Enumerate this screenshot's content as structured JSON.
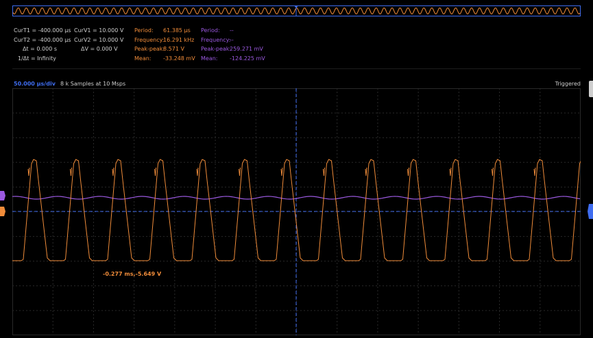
{
  "measurements": {
    "cursors": [
      {
        "label": "CurT1 = -400.000 µs",
        "value_label": "CurV1 = 10.000 V"
      },
      {
        "label": "CurT2 = -400.000 µs",
        "value_label": "CurV2 = 10.000 V"
      },
      {
        "label": "Δt = 0.000 s",
        "value_label": "ΔV = 0.000 V"
      },
      {
        "label": "1/Δt = Infinity",
        "value_label": ""
      }
    ],
    "channel1": {
      "period_label": "Period:",
      "period": "61.385 µs",
      "frequency_label": "Frequency:",
      "frequency": "16.291 kHz",
      "peak_peak_label": "Peak-peak:",
      "peak_peak": "8.571 V",
      "mean_label": "Mean:",
      "mean": "-33.248 mV"
    },
    "channel2": {
      "period_label": "Period:",
      "period": "--",
      "frequency_label": "Frequency:",
      "frequency": "--",
      "peak_peak_label": "Peak-peak:",
      "peak_peak": "259.271 mV",
      "mean_label": "Mean:",
      "mean": "-124.225 mV"
    }
  },
  "status": {
    "timebase": "50.000 µs/div",
    "samples": "8 k Samples at 10 Msps",
    "trigger_state": "Triggered"
  },
  "cursor_readout": "-0.277 ms,-5.649 V",
  "colors": {
    "ch1": "#f08c3a",
    "ch2": "#9b59e0",
    "cursor": "#3f6df0",
    "grid": "#2a2a2a",
    "background": "#000000"
  },
  "icons": {
    "ch2_marker": "ch2-offset-marker-icon",
    "ch1_marker": "ch1-offset-marker-icon",
    "trigger_marker": "trigger-level-marker-icon",
    "scroll_handle": "scroll-handle-icon"
  }
}
